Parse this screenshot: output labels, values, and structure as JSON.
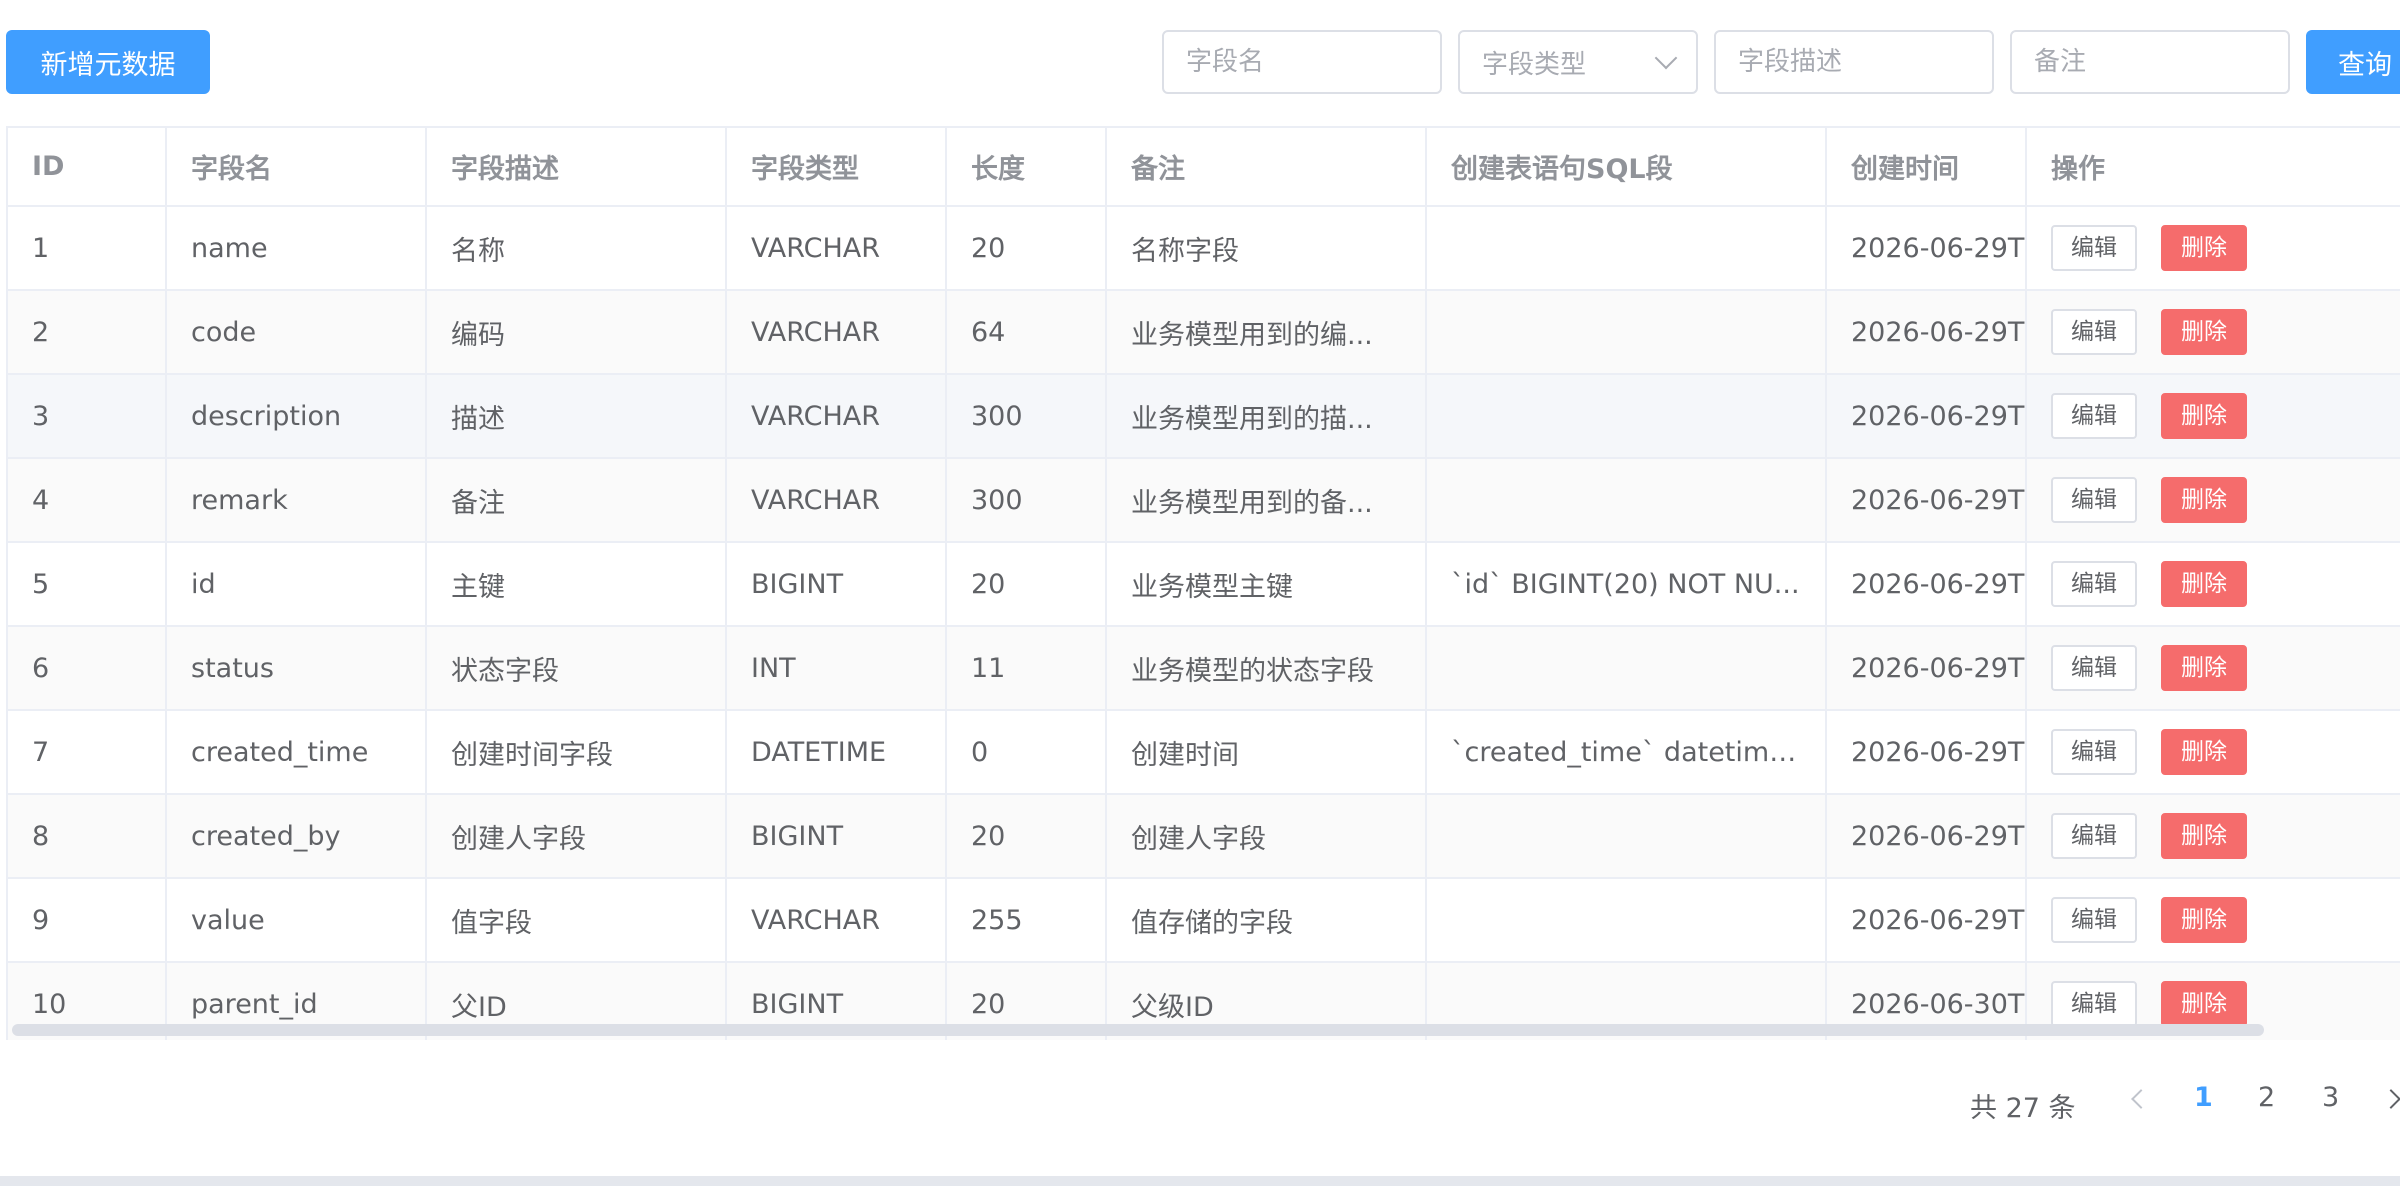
{
  "toolbar": {
    "add_label": "新增元数据",
    "query_label": "查询",
    "filters": {
      "name_placeholder": "字段名",
      "type_placeholder": "字段类型",
      "desc_placeholder": "字段描述",
      "remark_placeholder": "备注"
    }
  },
  "table": {
    "columns": [
      "ID",
      "字段名",
      "字段描述",
      "字段类型",
      "长度",
      "备注",
      "创建表语句SQL段",
      "创建时间",
      "操作"
    ],
    "edit_label": "编辑",
    "delete_label": "删除",
    "rows": [
      [
        "1",
        "name",
        "名称",
        "VARCHAR",
        "20",
        "名称字段",
        "",
        "2026-06-29T"
      ],
      [
        "2",
        "code",
        "编码",
        "VARCHAR",
        "64",
        "业务模型用到的编...",
        "",
        "2026-06-29T"
      ],
      [
        "3",
        "description",
        "描述",
        "VARCHAR",
        "300",
        "业务模型用到的描...",
        "",
        "2026-06-29T"
      ],
      [
        "4",
        "remark",
        "备注",
        "VARCHAR",
        "300",
        "业务模型用到的备...",
        "",
        "2026-06-29T"
      ],
      [
        "5",
        "id",
        "主键",
        "BIGINT",
        "20",
        "业务模型主键",
        "`id` BIGINT(20) NOT NU...",
        "2026-06-29T"
      ],
      [
        "6",
        "status",
        "状态字段",
        "INT",
        "11",
        "业务模型的状态字段",
        "",
        "2026-06-29T"
      ],
      [
        "7",
        "created_time",
        "创建时间字段",
        "DATETIME",
        "0",
        "创建时间",
        "`created_time` datetime...",
        "2026-06-29T"
      ],
      [
        "8",
        "created_by",
        "创建人字段",
        "BIGINT",
        "20",
        "创建人字段",
        "",
        "2026-06-29T"
      ],
      [
        "9",
        "value",
        "值字段",
        "VARCHAR",
        "255",
        "值存储的字段",
        "",
        "2026-06-29T"
      ],
      [
        "10",
        "parent_id",
        "父ID",
        "BIGINT",
        "20",
        "父级ID",
        "",
        "2026-06-30T"
      ]
    ]
  },
  "pagination": {
    "total_text": "共 27 条",
    "pages": [
      "1",
      "2",
      "3"
    ],
    "current_page": "1"
  },
  "colors": {
    "primary": "#409eff",
    "danger": "#f56c6c"
  }
}
